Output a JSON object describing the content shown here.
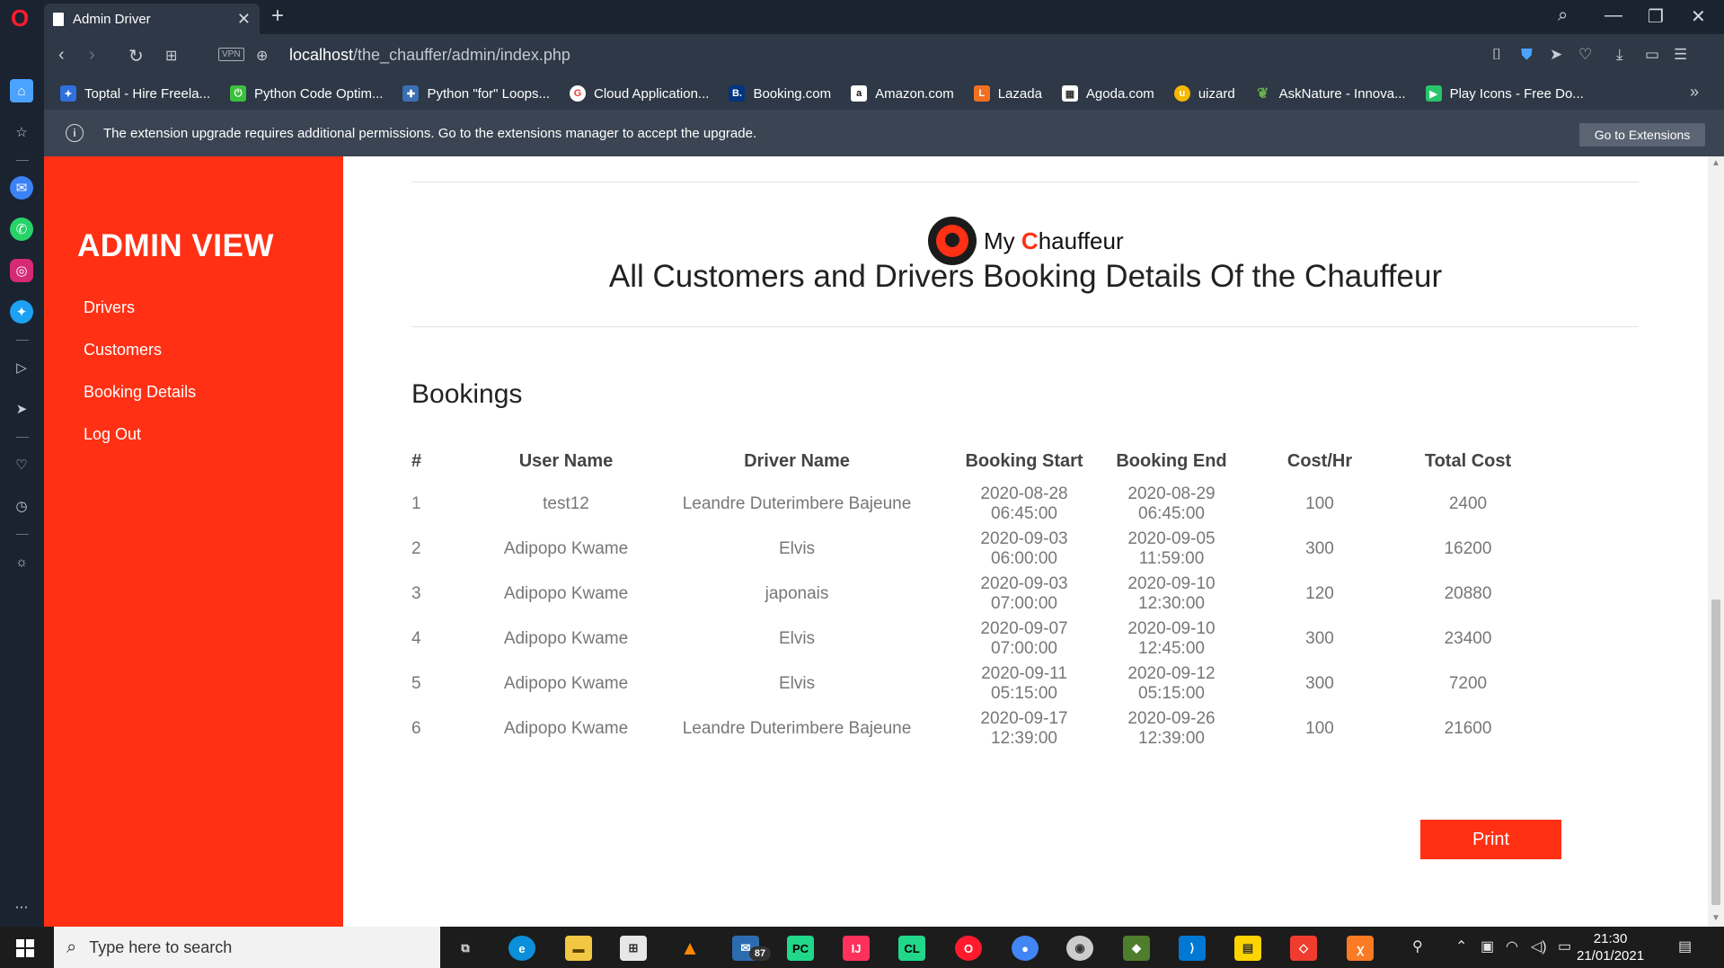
{
  "browser": {
    "tab_title": "Admin Driver",
    "url_host": "localhost",
    "url_path": "/the_chauffer/admin/index.php",
    "vpn_label": "VPN",
    "bookmarks": [
      {
        "label": "Toptal - Hire Freela...",
        "color": "#2f6fde"
      },
      {
        "label": "Python Code Optim...",
        "color": "#3cbf3c"
      },
      {
        "label": "Python \"for\" Loops...",
        "color": "#3b6fb5"
      },
      {
        "label": "Cloud Application...",
        "color": "#ea4335"
      },
      {
        "label": "Booking.com",
        "color": "#003580"
      },
      {
        "label": "Amazon.com",
        "color": "#ffffff"
      },
      {
        "label": "Lazada",
        "color": "#f36f21"
      },
      {
        "label": "Agoda.com",
        "color": "#ffffff"
      },
      {
        "label": "uizard",
        "color": "#f5b800"
      },
      {
        "label": "AskNature - Innova...",
        "color": "#6ab04c"
      },
      {
        "label": "Play Icons - Free Do...",
        "color": "#27c46b"
      }
    ],
    "info_message": "The extension upgrade requires additional permissions. Go to the extensions manager to accept the upgrade.",
    "info_button": "Go to Extensions"
  },
  "sidebar": {
    "title": "ADMIN VIEW",
    "items": [
      "Drivers",
      "Customers",
      "Booking Details",
      "Log Out"
    ]
  },
  "main": {
    "logo_my": "My",
    "logo_c": "C",
    "logo_rest": "hauffeur",
    "page_title": "All Customers and Drivers Booking Details Of the Chauffeur",
    "section_title": "Bookings",
    "print_label": "Print",
    "columns": [
      "#",
      "User Name",
      "Driver Name",
      "Booking Start",
      "Booking End",
      "Cost/Hr",
      "Total Cost"
    ],
    "rows": [
      {
        "num": "1",
        "user": "test12",
        "driver": "Leandre Duterimbere Bajeune",
        "start_date": "2020-08-28",
        "start_time": "06:45:00",
        "end_date": "2020-08-29",
        "end_time": "06:45:00",
        "cost_hr": "100",
        "total": "2400"
      },
      {
        "num": "2",
        "user": "Adipopo Kwame",
        "driver": "Elvis",
        "start_date": "2020-09-03",
        "start_time": "06:00:00",
        "end_date": "2020-09-05",
        "end_time": "11:59:00",
        "cost_hr": "300",
        "total": "16200"
      },
      {
        "num": "3",
        "user": "Adipopo Kwame",
        "driver": "japonais",
        "start_date": "2020-09-03",
        "start_time": "07:00:00",
        "end_date": "2020-09-10",
        "end_time": "12:30:00",
        "cost_hr": "120",
        "total": "20880"
      },
      {
        "num": "4",
        "user": "Adipopo Kwame",
        "driver": "Elvis",
        "start_date": "2020-09-07",
        "start_time": "07:00:00",
        "end_date": "2020-09-10",
        "end_time": "12:45:00",
        "cost_hr": "300",
        "total": "23400"
      },
      {
        "num": "5",
        "user": "Adipopo Kwame",
        "driver": "Elvis",
        "start_date": "2020-09-11",
        "start_time": "05:15:00",
        "end_date": "2020-09-12",
        "end_time": "05:15:00",
        "cost_hr": "300",
        "total": "7200"
      },
      {
        "num": "6",
        "user": "Adipopo Kwame",
        "driver": "Leandre Duterimbere Bajeune",
        "start_date": "2020-09-17",
        "start_time": "12:39:00",
        "end_date": "2020-09-26",
        "end_time": "12:39:00",
        "cost_hr": "100",
        "total": "21600"
      }
    ]
  },
  "taskbar": {
    "search_placeholder": "Type here to search",
    "mail_badge": "87",
    "time": "21:30",
    "date": "21/01/2021"
  },
  "colors": {
    "accent": "#ff3014",
    "chrome_dark": "#1b2330",
    "chrome": "#2e3846"
  }
}
